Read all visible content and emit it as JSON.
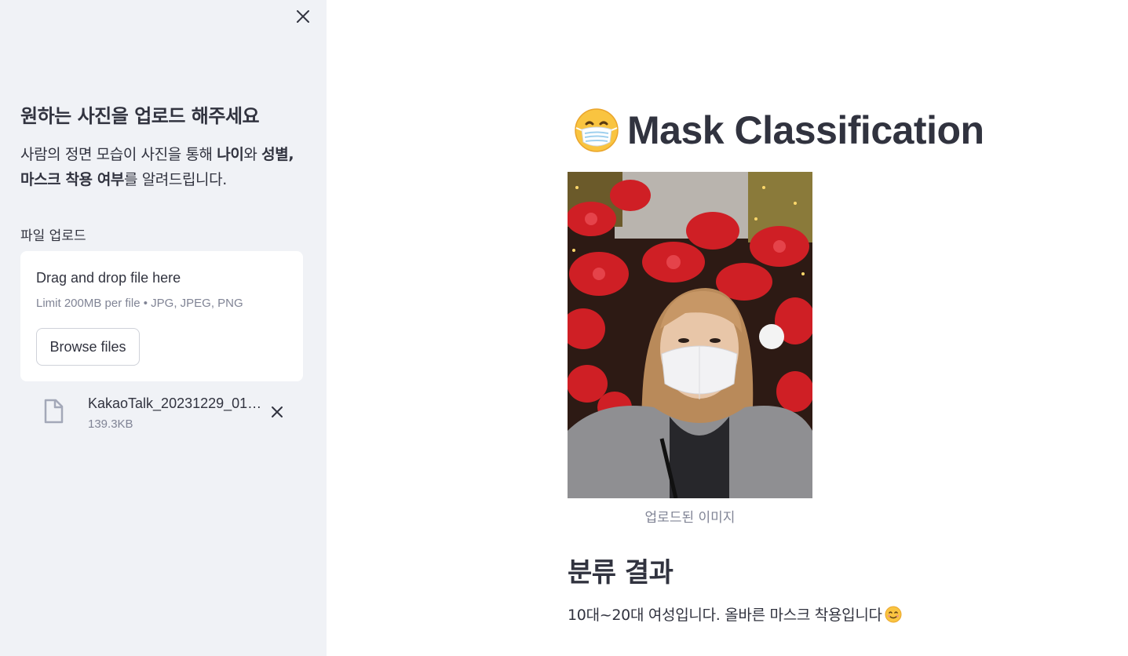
{
  "sidebar": {
    "title": "원하는 사진을 업로드 해주세요",
    "description": {
      "part1": "사람의 정면 모습이 사진을 통해 ",
      "bold1": "나이",
      "part2": "와 ",
      "bold2": "성별, 마스크 착용 여부",
      "part3": "를 알려드립니다."
    },
    "uploader": {
      "label": "파일 업로드",
      "drop_text": "Drag and drop file here",
      "limit_text": "Limit 200MB per file • JPG, JPEG, PNG",
      "browse_label": "Browse files"
    },
    "uploaded_file": {
      "name": "KakaoTalk_20231229_01…",
      "size": "139.3KB",
      "icon": "file-icon"
    },
    "close_icon": "close-icon"
  },
  "main": {
    "title_emoji": "mask-face-emoji",
    "title": "Mask Classification",
    "image_caption": "업로드된 이미지",
    "result_heading": "분류 결과",
    "result_text": "10대~20대 여성입니다. 올바른 마스크 착용입니다",
    "result_emoji": "smiling-face-emoji"
  },
  "colors": {
    "sidebar_bg": "#f0f2f6",
    "text": "#31333f",
    "muted": "#808495",
    "emoji_yellow": "#f9c440"
  }
}
